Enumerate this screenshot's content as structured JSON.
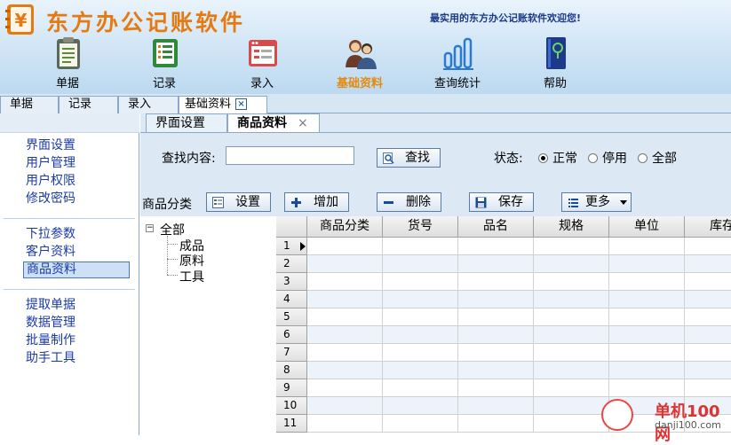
{
  "app": {
    "title": "东方办公记账软件",
    "welcome": "最实用的东方办公记账软件欢迎您!",
    "logo_symbol": "¥"
  },
  "nav": [
    {
      "label": "单据",
      "icon": "clipboard-icon",
      "active": false
    },
    {
      "label": "记录",
      "icon": "list-icon",
      "active": false
    },
    {
      "label": "录入",
      "icon": "form-window-icon",
      "active": false
    },
    {
      "label": "基础资料",
      "icon": "users-icon",
      "active": true
    },
    {
      "label": "查询统计",
      "icon": "bar-chart-icon",
      "active": false
    },
    {
      "label": "帮助",
      "icon": "help-book-icon",
      "active": false
    }
  ],
  "top_tabs": [
    "单据",
    "记录",
    "录入",
    "基础资料"
  ],
  "top_tab_close": "×",
  "sidebar": {
    "group1": [
      "界面设置",
      "用户管理",
      "用户权限",
      "修改密码"
    ],
    "group2": [
      "下拉参数",
      "客户资料",
      "商品资料"
    ],
    "group3": [
      "提取单据",
      "数据管理",
      "批量制作",
      "助手工具"
    ],
    "selected": "商品资料"
  },
  "content_tabs": [
    "界面设置",
    "商品资料"
  ],
  "content_tab_close": "×",
  "search": {
    "label": "查找内容:",
    "value": "",
    "button": "查找"
  },
  "status": {
    "label": "状态:",
    "options": [
      "正常",
      "停用",
      "全部"
    ],
    "selected": "正常"
  },
  "toolbar": {
    "category_label": "商品分类",
    "settings": "设置",
    "add": "增加",
    "delete": "删除",
    "save": "保存",
    "more": "更多"
  },
  "tree": {
    "root": "全部",
    "expander": "−",
    "children": [
      "成品",
      "原料",
      "工具"
    ]
  },
  "grid": {
    "columns": [
      "商品分类",
      "货号",
      "品名",
      "规格",
      "单位",
      "库存"
    ],
    "rows": [
      "1",
      "2",
      "3",
      "4",
      "5",
      "6",
      "7",
      "8",
      "9",
      "10",
      "11"
    ]
  },
  "watermark": {
    "text": "单机100网",
    "url": "danji100.com"
  },
  "colors": {
    "accent_orange": "#e57a12",
    "link_blue": "#1a3aa8",
    "header_bg": "#cfe4f5"
  }
}
